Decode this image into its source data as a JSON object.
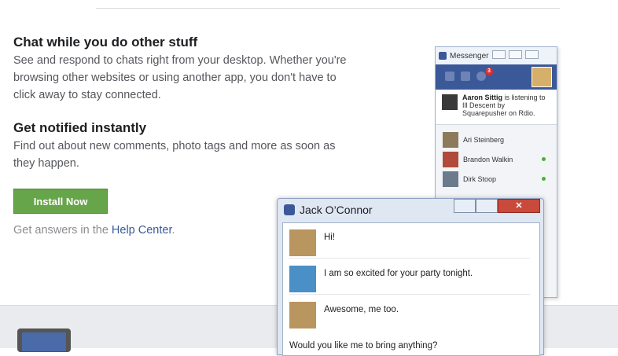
{
  "features": [
    {
      "title": "Chat while you do other stuff",
      "lines": [
        "See and respond to chats right from your desktop. Whether you're",
        "browsing other websites or using another app, you don't have to",
        "click away to stay connected."
      ]
    },
    {
      "title": "Get notified instantly",
      "lines": [
        "Find out about new comments, photo tags and more as soon as",
        "they happen."
      ]
    }
  ],
  "install_button": "Install Now",
  "help": {
    "prefix": "Get answers in the ",
    "link": "Help Center",
    "suffix": "."
  },
  "messenger": {
    "title": "Messenger",
    "badge_count": "3",
    "notice": {
      "name": "Aaron Sittig",
      "text": " is listening to Ill Descent by Squarepusher on Rdio."
    },
    "friends": [
      {
        "name": "Ari Steinberg",
        "online": false
      },
      {
        "name": "Brandon Walkin",
        "online": true
      },
      {
        "name": "Dirk Stoop",
        "online": true
      }
    ]
  },
  "chat": {
    "title": "Jack O’Connor",
    "messages": [
      {
        "text": "Hi!"
      },
      {
        "text": "I am so excited for your party tonight."
      },
      {
        "text": "Awesome, me too."
      }
    ],
    "input_text": "Would you like me to bring anything?"
  }
}
